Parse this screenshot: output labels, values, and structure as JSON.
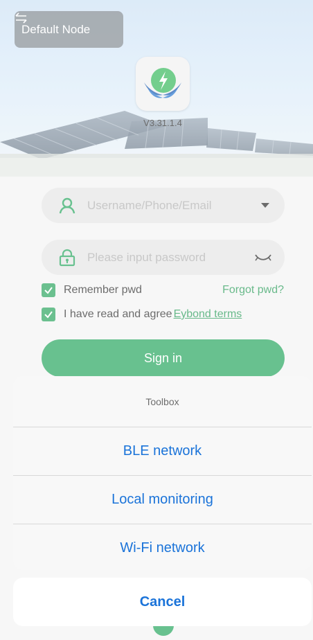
{
  "header": {
    "node_label": "Default Node",
    "version": "V3.31.1.4"
  },
  "login": {
    "username_placeholder": "Username/Phone/Email",
    "password_placeholder": "Please input password",
    "remember_label": "Remember pwd",
    "forgot_label": "Forgot pwd?",
    "agree_label": "I have read and agree",
    "terms_label": "Eybond terms",
    "signin_label": "Sign in"
  },
  "toolbox": {
    "title": "Toolbox",
    "items": [
      {
        "label": "BLE network"
      },
      {
        "label": "Local monitoring"
      },
      {
        "label": "Wi-Fi network"
      }
    ],
    "cancel_label": "Cancel"
  },
  "colors": {
    "accent_green": "#2eaa64",
    "action_blue": "#1a73d9"
  },
  "icons": [
    "swap-icon",
    "app-logo-icon",
    "user-icon",
    "dropdown-arrow-icon",
    "lock-icon",
    "eye-closed-icon",
    "checkbox-icon"
  ]
}
